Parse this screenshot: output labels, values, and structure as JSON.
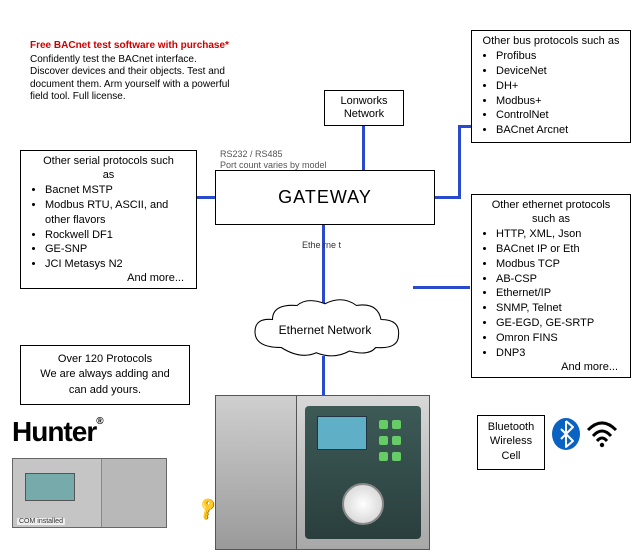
{
  "promo": {
    "headline": "Free BACnet test software with purchase*",
    "body": "Confidently test the BACnet interface. Discover devices and their objects. Test and document them. Arm yourself with a powerful field tool. Full license."
  },
  "serial_box": {
    "title_l1": "Other serial protocols such",
    "title_l2": "as",
    "items": [
      "Bacnet MSTP",
      "Modbus RTU, ASCII, and other flavors",
      "Rockwell DF1",
      "GE-SNP",
      "JCI Metasys N2"
    ],
    "more": "And more..."
  },
  "bus_box": {
    "title": "Other bus protocols such as",
    "items": [
      "Profibus",
      "DeviceNet",
      "DH+",
      "Modbus+",
      "ControlNet",
      "BACnet Arcnet"
    ]
  },
  "eth_box": {
    "title_l1": "Other ethernet protocols",
    "title_l2": "such as",
    "items": [
      "HTTP, XML, Json",
      "BACnet IP or Eth",
      "Modbus TCP",
      "AB-CSP",
      "Ethernet/IP",
      "SNMP, Telnet",
      "GE-EGD, GE-SRTP",
      "Omron FINS",
      "DNP3"
    ],
    "more": "And more..."
  },
  "gateway": {
    "label": "GATEWAY"
  },
  "rs232": {
    "l1": "RS232 / RS485",
    "l2": "Port count varies by model"
  },
  "ethernet_label": "Ethe rne t",
  "cloud_label": "Ethernet Network",
  "lonworks": {
    "l1": "Lonworks",
    "l2": "Network"
  },
  "count_box": {
    "l1": "Over 120 Protocols",
    "l2": "We are always adding and",
    "l3": "can add yours."
  },
  "bt_box": {
    "l1": "Bluetooth",
    "l2": "Wireless",
    "l3": "Cell"
  },
  "hunter": {
    "text": "Hunter",
    "reg": "®"
  },
  "mini_tag": "COM installed"
}
